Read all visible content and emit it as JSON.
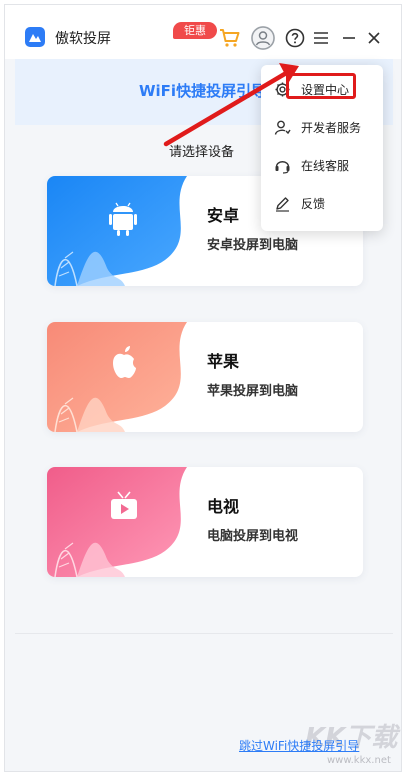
{
  "app": {
    "title": "傲软投屏",
    "promo_badge": "钜惠"
  },
  "banner": {
    "title": "WiFi快捷投屏引导"
  },
  "select_label": "请选择设备",
  "devices": [
    {
      "title": "安卓",
      "subtitle": "安卓投屏到电脑",
      "icon": "android-icon"
    },
    {
      "title": "苹果",
      "subtitle": "苹果投屏到电脑",
      "icon": "apple-icon"
    },
    {
      "title": "电视",
      "subtitle": "电脑投屏到电视",
      "icon": "tv-icon"
    }
  ],
  "menu": {
    "items": [
      {
        "label": "设置中心",
        "icon": "gear-icon"
      },
      {
        "label": "开发者服务",
        "icon": "developer-icon"
      },
      {
        "label": "在线客服",
        "icon": "headset-icon"
      },
      {
        "label": "反馈",
        "icon": "pencil-icon"
      }
    ]
  },
  "footer": {
    "skip_link": "跳过WiFi快捷投屏引导"
  },
  "watermark": {
    "text": "KK下载",
    "url": "www.kkx.net"
  },
  "colors": {
    "brand_blue": "#2d7cf6",
    "android_gradient": [
      "#1a86f5",
      "#5fb6ff"
    ],
    "apple_gradient": [
      "#f78a77",
      "#ffc3a6"
    ],
    "tv_gradient": [
      "#f05d8a",
      "#ffb0c7"
    ],
    "highlight_red": "#e01b1b",
    "promo_red": "#f04a4a"
  }
}
